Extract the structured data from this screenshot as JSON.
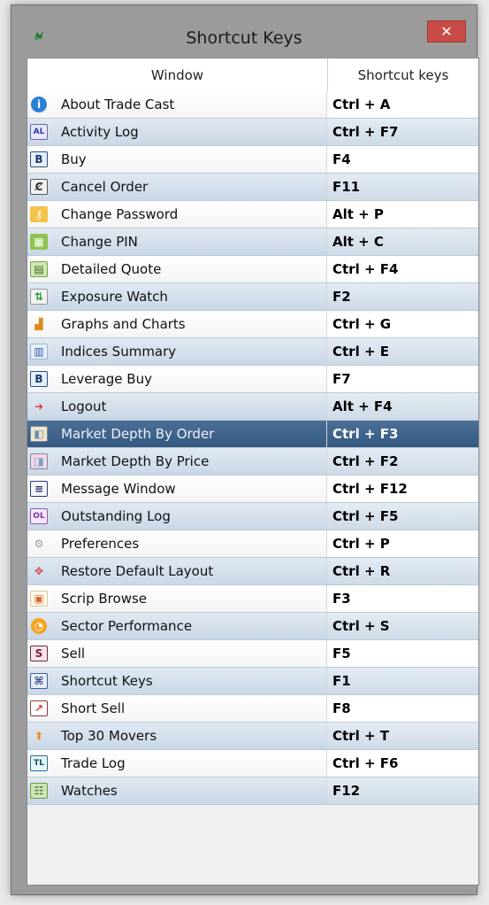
{
  "window": {
    "title": "Shortcut Keys",
    "close_glyph": "✕"
  },
  "table": {
    "headers": [
      "Window",
      "Shortcut keys"
    ],
    "rows": [
      {
        "icon": "info-icon",
        "label": "About Trade Cast",
        "shortcut": "Ctrl + A"
      },
      {
        "icon": "activity-log-icon",
        "label": "Activity Log",
        "shortcut": "Ctrl + F7"
      },
      {
        "icon": "buy-icon",
        "label": "Buy",
        "shortcut": "F4"
      },
      {
        "icon": "cancel-order-icon",
        "label": "Cancel Order",
        "shortcut": "F11"
      },
      {
        "icon": "password-icon",
        "label": "Change Password",
        "shortcut": "Alt + P"
      },
      {
        "icon": "pin-icon",
        "label": "Change PIN",
        "shortcut": "Alt + C"
      },
      {
        "icon": "quote-icon",
        "label": "Detailed Quote",
        "shortcut": "Ctrl + F4"
      },
      {
        "icon": "exposure-icon",
        "label": "Exposure Watch",
        "shortcut": "F2"
      },
      {
        "icon": "chart-icon",
        "label": "Graphs and Charts",
        "shortcut": "Ctrl + G"
      },
      {
        "icon": "indices-icon",
        "label": "Indices Summary",
        "shortcut": "Ctrl + E"
      },
      {
        "icon": "leverage-buy-icon",
        "label": "Leverage Buy",
        "shortcut": "F7"
      },
      {
        "icon": "logout-icon",
        "label": "Logout",
        "shortcut": "Alt + F4"
      },
      {
        "icon": "depth-order-icon",
        "label": "Market Depth By Order",
        "shortcut": "Ctrl + F3",
        "selected": true
      },
      {
        "icon": "depth-price-icon",
        "label": "Market Depth By Price",
        "shortcut": "Ctrl + F2"
      },
      {
        "icon": "message-icon",
        "label": "Message Window",
        "shortcut": "Ctrl + F12"
      },
      {
        "icon": "outstanding-log-icon",
        "label": "Outstanding Log",
        "shortcut": "Ctrl + F5"
      },
      {
        "icon": "gear-icon",
        "label": "Preferences",
        "shortcut": "Ctrl + P"
      },
      {
        "icon": "restore-layout-icon",
        "label": "Restore Default Layout",
        "shortcut": "Ctrl + R"
      },
      {
        "icon": "scrip-browse-icon",
        "label": "Scrip Browse",
        "shortcut": "F3"
      },
      {
        "icon": "pie-icon",
        "label": "Sector Performance",
        "shortcut": "Ctrl + S"
      },
      {
        "icon": "sell-icon",
        "label": "Sell",
        "shortcut": "F5"
      },
      {
        "icon": "shortcut-keys-icon",
        "label": "Shortcut Keys",
        "shortcut": "F1"
      },
      {
        "icon": "short-sell-icon",
        "label": "Short Sell",
        "shortcut": "F8"
      },
      {
        "icon": "top-movers-icon",
        "label": "Top 30 Movers",
        "shortcut": "Ctrl + T"
      },
      {
        "icon": "trade-log-icon",
        "label": "Trade Log",
        "shortcut": "Ctrl + F6"
      },
      {
        "icon": "watches-icon",
        "label": "Watches",
        "shortcut": "F12"
      }
    ]
  },
  "icon_text": {
    "activity-log-icon": "AL",
    "buy-icon": "B",
    "leverage-buy-icon": "B",
    "sell-icon": "S",
    "outstanding-log-icon": "OL",
    "trade-log-icon": "TL",
    "cancel-order-icon": "Ȼ"
  }
}
